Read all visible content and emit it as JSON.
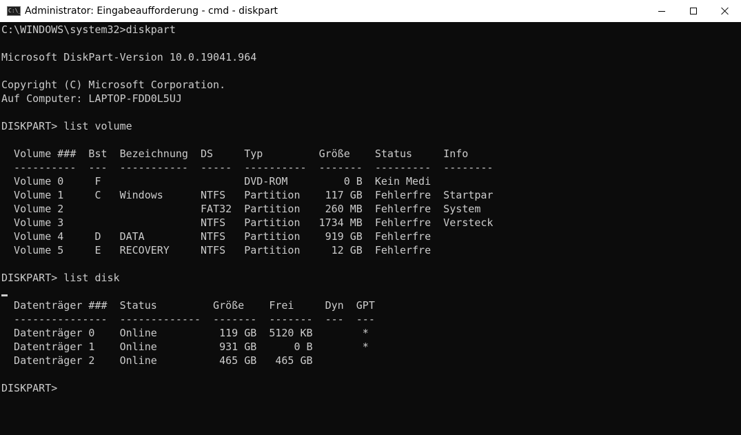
{
  "window": {
    "title": "Administrator: Eingabeaufforderung - cmd - diskpart",
    "app_icon_glyph": "C:\\_",
    "controls": {
      "minimize": "minimize-icon",
      "maximize": "maximize-icon",
      "close": "close-icon"
    }
  },
  "console": {
    "lines": [
      "C:\\WINDOWS\\system32>diskpart",
      "",
      "Microsoft DiskPart-Version 10.0.19041.964",
      "",
      "Copyright (C) Microsoft Corporation.",
      "Auf Computer: LAPTOP-FDD0L5UJ",
      "",
      "DISKPART> list volume",
      "",
      "  Volume ###  Bst  Bezeichnung  DS     Typ         Größe    Status     Info",
      "  ----------  ---  -----------  -----  ----------  -------  ---------  --------",
      "  Volume 0     F                       DVD-ROM         0 B  Kein Medi",
      "  Volume 1     C   Windows      NTFS   Partition    117 GB  Fehlerfre  Startpar",
      "  Volume 2                      FAT32  Partition    260 MB  Fehlerfre  System",
      "  Volume 3                      NTFS   Partition   1734 MB  Fehlerfre  Versteck",
      "  Volume 4     D   DATA         NTFS   Partition    919 GB  Fehlerfre",
      "  Volume 5     E   RECOVERY     NTFS   Partition     12 GB  Fehlerfre",
      "",
      "DISKPART> list disk",
      "",
      "  Datenträger ###  Status         Größe    Frei     Dyn  GPT",
      "  ---------------  -------------  -------  -------  ---  ---",
      "  Datenträger 0    Online          119 GB  5120 KB        *",
      "  Datenträger 1    Online          931 GB      0 B        *",
      "  Datenträger 2    Online          465 GB   465 GB",
      "",
      "DISKPART>"
    ]
  }
}
